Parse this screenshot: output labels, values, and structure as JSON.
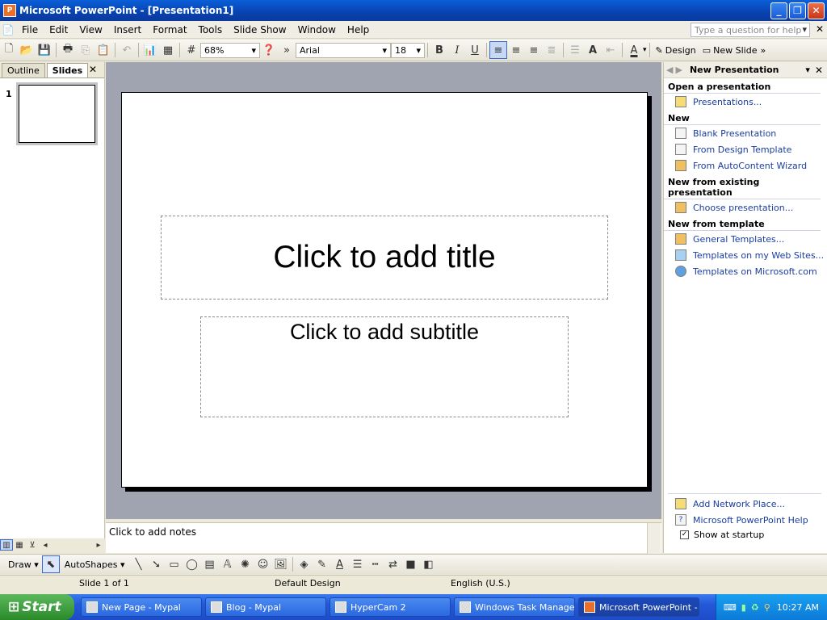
{
  "window": {
    "title": "Microsoft PowerPoint - [Presentation1]"
  },
  "menu": {
    "items": [
      "File",
      "Edit",
      "View",
      "Insert",
      "Format",
      "Tools",
      "Slide Show",
      "Window",
      "Help"
    ],
    "help_placeholder": "Type a question for help"
  },
  "toolbar": {
    "zoom": "68%",
    "font": "Arial",
    "size": "18",
    "bold": "B",
    "italic": "I",
    "underline": "U",
    "design": "Design",
    "new_slide": "New Slide"
  },
  "leftpane": {
    "tabs": [
      "Outline",
      "Slides"
    ],
    "slide_number": "1"
  },
  "slide": {
    "title_placeholder": "Click to add title",
    "subtitle_placeholder": "Click to add subtitle"
  },
  "notes": {
    "placeholder": "Click to add notes"
  },
  "taskpane": {
    "title": "New Presentation",
    "sections": [
      {
        "heading": "Open a presentation",
        "links": [
          "Presentations..."
        ]
      },
      {
        "heading": "New",
        "links": [
          "Blank Presentation",
          "From Design Template",
          "From AutoContent Wizard"
        ]
      },
      {
        "heading": "New from existing presentation",
        "links": [
          "Choose presentation..."
        ]
      },
      {
        "heading": "New from template",
        "links": [
          "General Templates...",
          "Templates on my Web Sites...",
          "Templates on Microsoft.com"
        ]
      }
    ],
    "footer_links": [
      "Add Network Place...",
      "Microsoft PowerPoint Help"
    ],
    "show_at_startup": "Show at startup"
  },
  "drawbar": {
    "draw": "Draw",
    "autoshapes": "AutoShapes"
  },
  "status": {
    "slide": "Slide 1 of 1",
    "design": "Default Design",
    "language": "English (U.S.)"
  },
  "taskbar": {
    "start": "Start",
    "tasks": [
      "New Page - Mypal",
      "Blog - Mypal",
      "HyperCam 2",
      "Windows Task Manager",
      "Microsoft PowerPoint - ..."
    ],
    "clock": "10:27 AM"
  }
}
